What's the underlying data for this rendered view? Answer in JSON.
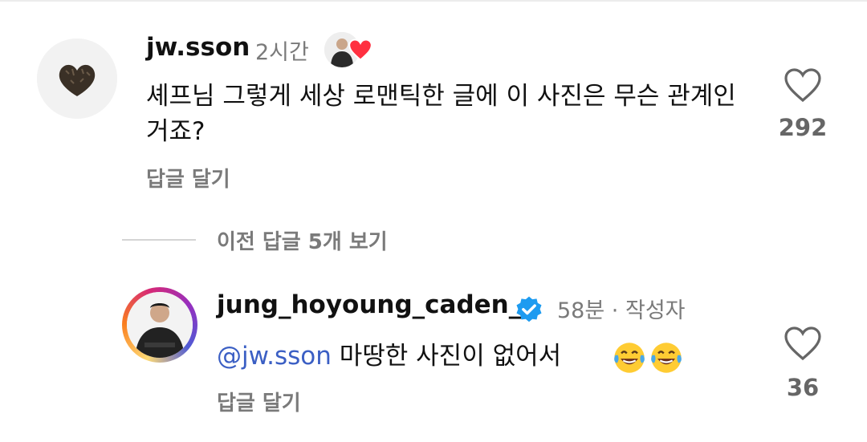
{
  "comments": [
    {
      "username": "jw.sson",
      "time": "2시간",
      "text": "셰프님 그렇게 세상 로맨틱한 글에 이 사진은 무슨 관계인거죠?",
      "reply_label": "답글 달기",
      "like_count": "292",
      "avatar_icon": "heart-shaped-truffle",
      "liked_by_author": true
    }
  ],
  "view_replies_label": "이전 답글 5개 보기",
  "reply": {
    "username": "jung_hoyoung_caden_",
    "verified": true,
    "time": "58분",
    "separator": "·",
    "author_label": "작성자",
    "mention": "@jw.sson",
    "text": "마땅한 사진이 없어서",
    "emojis": [
      "face-with-tears-of-joy",
      "face-with-tears-of-joy"
    ],
    "reply_label": "답글 달기",
    "like_count": "36"
  },
  "colors": {
    "mention": "#3b5fc4",
    "verified": "#1d9bf0",
    "heart_red": "#ff3040",
    "muted_text": "#7a7a7a"
  }
}
